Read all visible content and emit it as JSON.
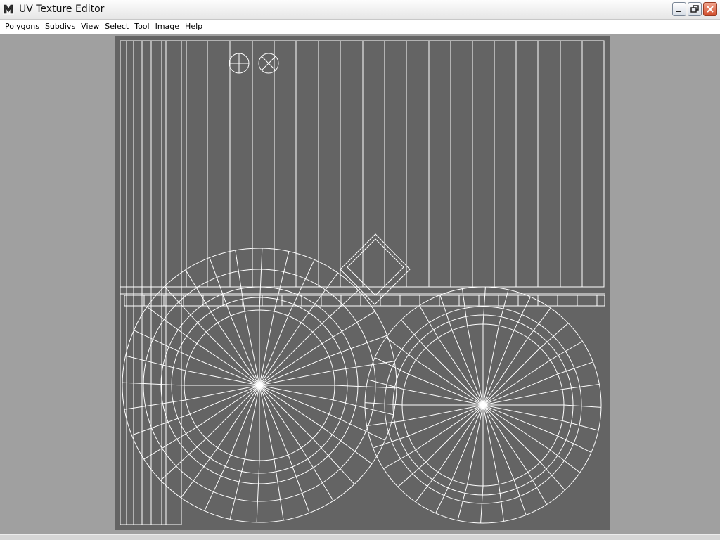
{
  "window": {
    "title": "UV Texture Editor",
    "icon": "maya-logo-icon",
    "controls": [
      "minimize-icon",
      "restore-icon",
      "close-icon"
    ]
  },
  "menubar": {
    "items": [
      {
        "label": "Polygons"
      },
      {
        "label": "Subdivs"
      },
      {
        "label": "View"
      },
      {
        "label": "Select"
      },
      {
        "label": "Tool"
      },
      {
        "label": "Image"
      },
      {
        "label": "Help"
      }
    ]
  },
  "colors": {
    "workspace": "#a0a0a0",
    "uv_background": "#646464",
    "uv_wire": "#ffffff"
  }
}
